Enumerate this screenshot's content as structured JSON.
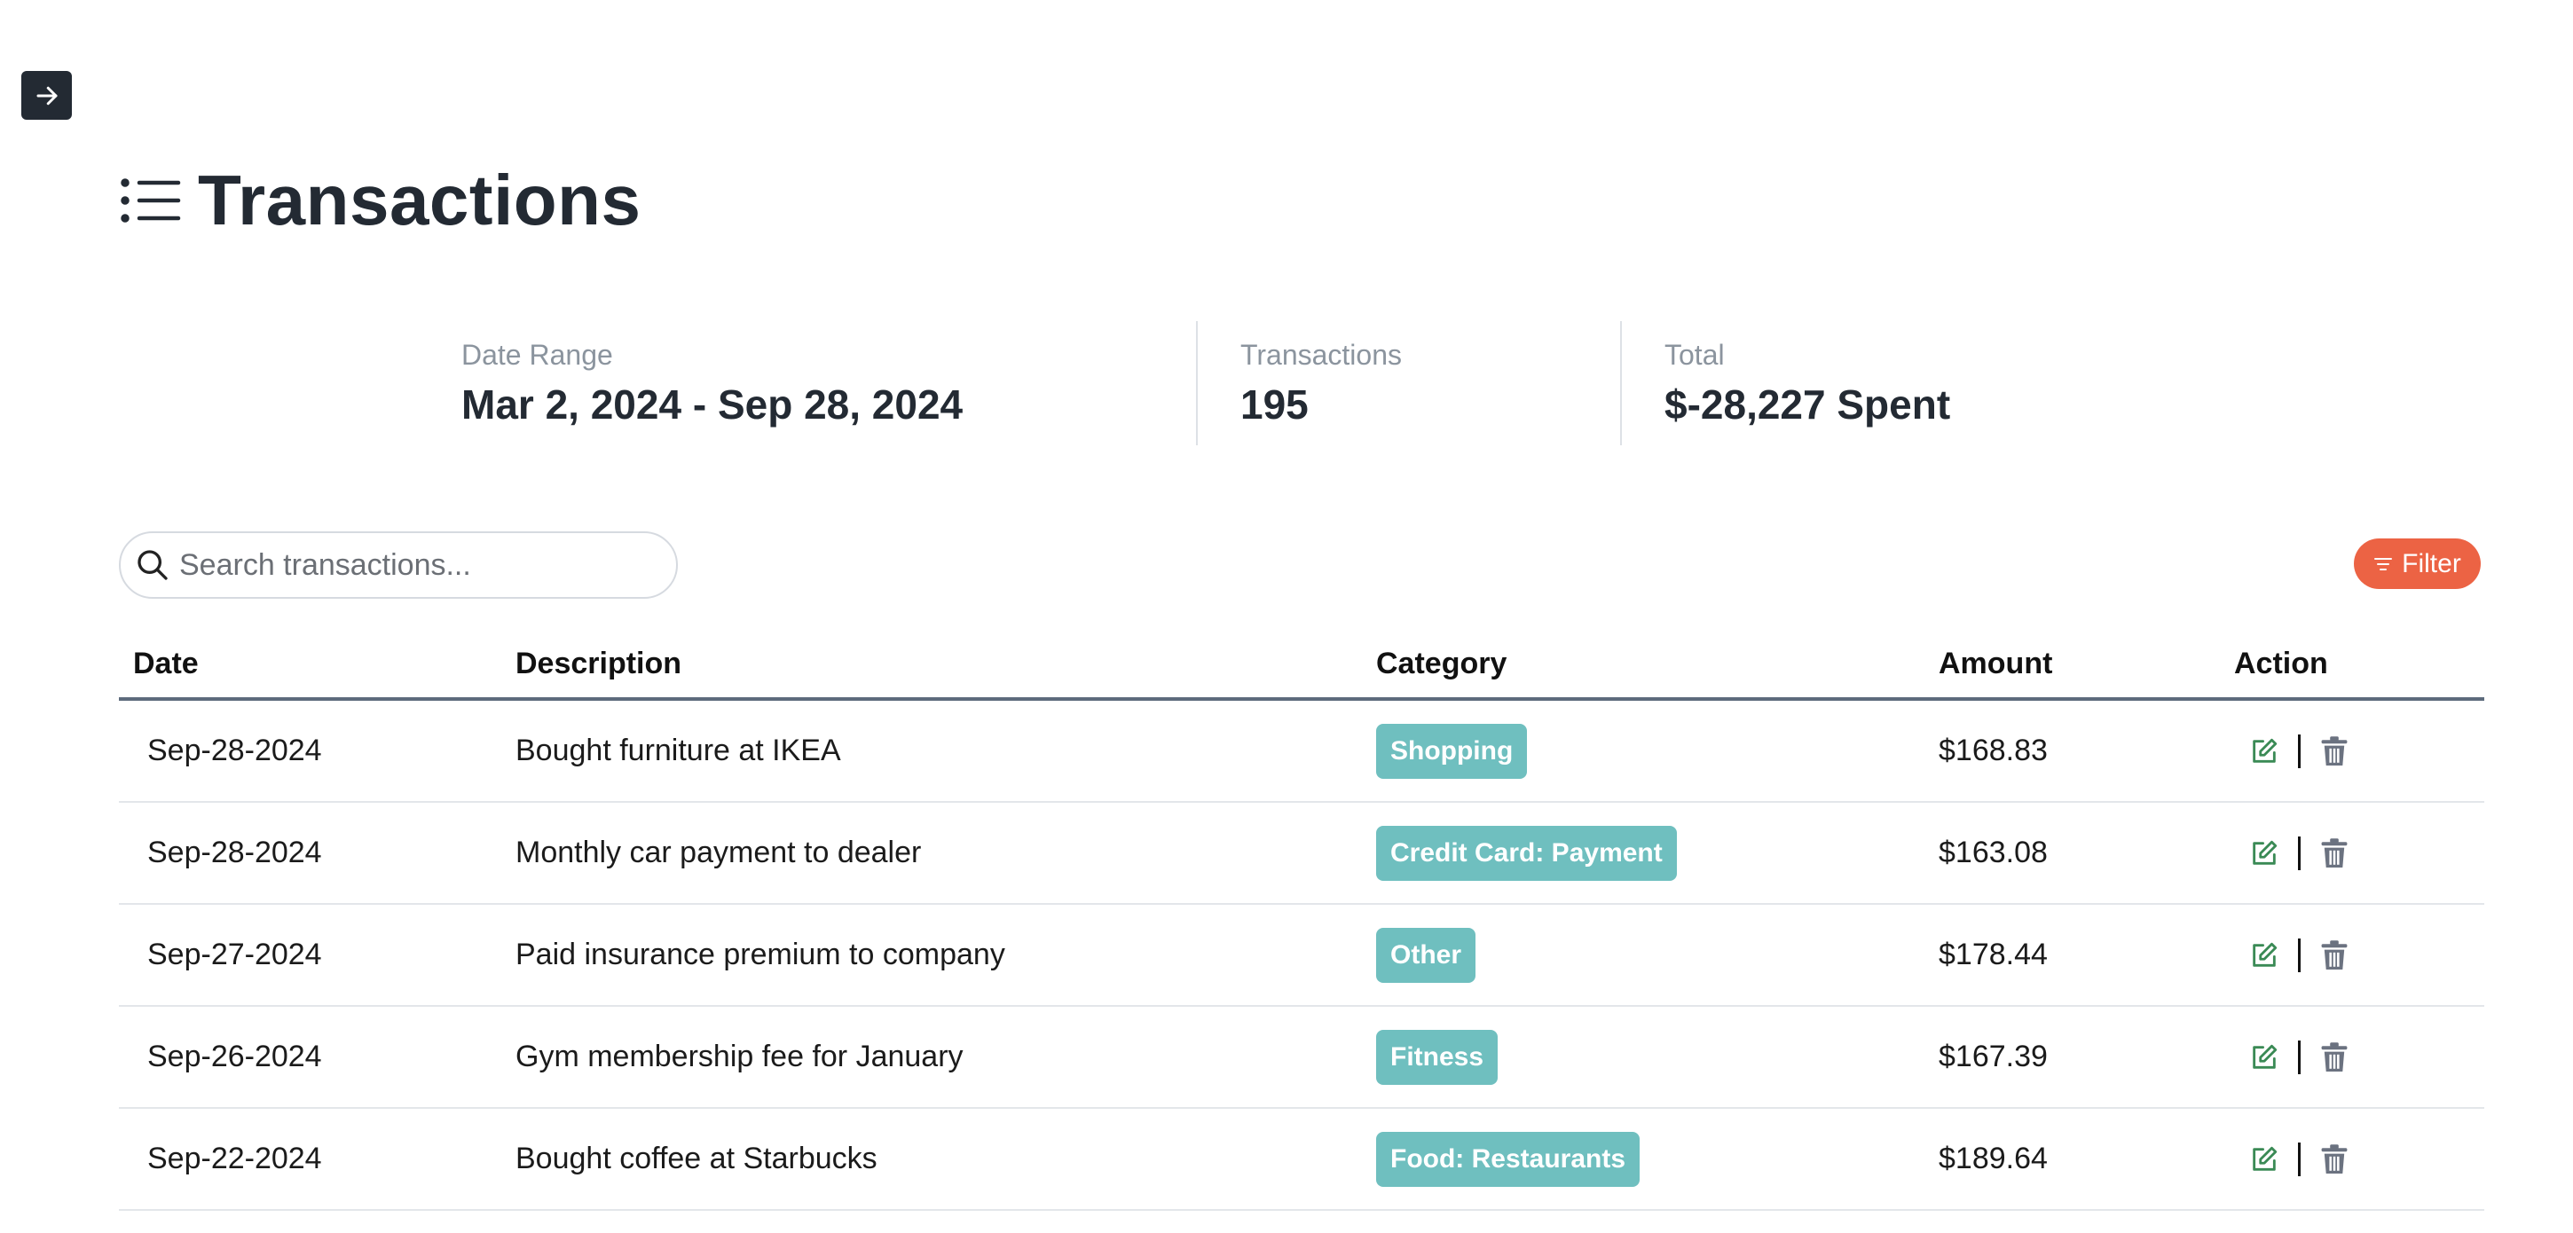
{
  "header": {
    "title": "Transactions",
    "icon": "list-icon"
  },
  "stats": {
    "date_range": {
      "label": "Date Range",
      "value": "Mar 2, 2024 - Sep 28, 2024"
    },
    "transactions": {
      "label": "Transactions",
      "value": "195"
    },
    "total": {
      "label": "Total",
      "value": "$-28,227 Spent"
    }
  },
  "search": {
    "placeholder": "Search transactions...",
    "value": ""
  },
  "filter": {
    "label": "Filter",
    "color": "#ec6344"
  },
  "table": {
    "columns": [
      "Date",
      "Description",
      "Category",
      "Amount",
      "Action"
    ],
    "rows": [
      {
        "date": "Sep-28-2024",
        "description": "Bought furniture at IKEA",
        "category": "Shopping",
        "amount": "$168.83"
      },
      {
        "date": "Sep-28-2024",
        "description": "Monthly car payment to dealer",
        "category": "Credit Card: Payment",
        "amount": "$163.08"
      },
      {
        "date": "Sep-27-2024",
        "description": "Paid insurance premium to company",
        "category": "Other",
        "amount": "$178.44"
      },
      {
        "date": "Sep-26-2024",
        "description": "Gym membership fee for January",
        "category": "Fitness",
        "amount": "$167.39"
      },
      {
        "date": "Sep-22-2024",
        "description": "Bought coffee at Starbucks",
        "category": "Food: Restaurants",
        "amount": "$189.64"
      }
    ]
  },
  "colors": {
    "badge": "#6fbfbf",
    "edit_icon": "#3a8a55",
    "delete_icon": "#6b7280",
    "dark": "#232a33"
  }
}
